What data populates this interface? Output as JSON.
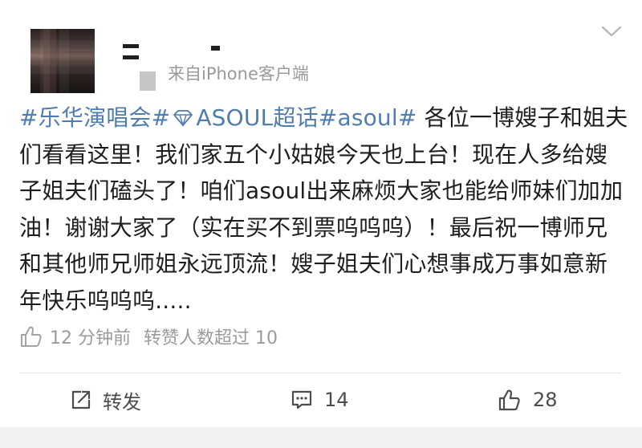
{
  "post": {
    "source_prefix": "来自",
    "source_device": "iPhone客户端",
    "body": {
      "tag1": "#乐华演唱会#",
      "tag2": "ASOUL超话",
      "tag3": "#asoul#",
      "text": " 各位一博嫂子和姐夫们看看这里！我们家五个小姑娘今天也上台！现在人多给嫂子姐夫们磕头了！咱们asoul出来麻烦大家也能给师妹们加加油！谢谢大家了（实在买不到票呜呜呜）！最后祝一博师兄和其他师兄师姐永远顶流！嫂子姐夫们心想事成万事如意新年快乐呜呜呜....."
    },
    "meta": {
      "time": "12 分钟前",
      "reposts_note": "转赞人数超过 10"
    }
  },
  "actions": {
    "repost_label": "转发",
    "comment_count": "14",
    "like_count": "28"
  },
  "colors": {
    "tag": "#507daf",
    "meta_gray": "#9b9b9b",
    "text": "#1e1e1e"
  },
  "icons": [
    "chevron-down-icon",
    "diamond-icon",
    "thumbs-up-icon",
    "repost-icon",
    "comment-icon"
  ]
}
